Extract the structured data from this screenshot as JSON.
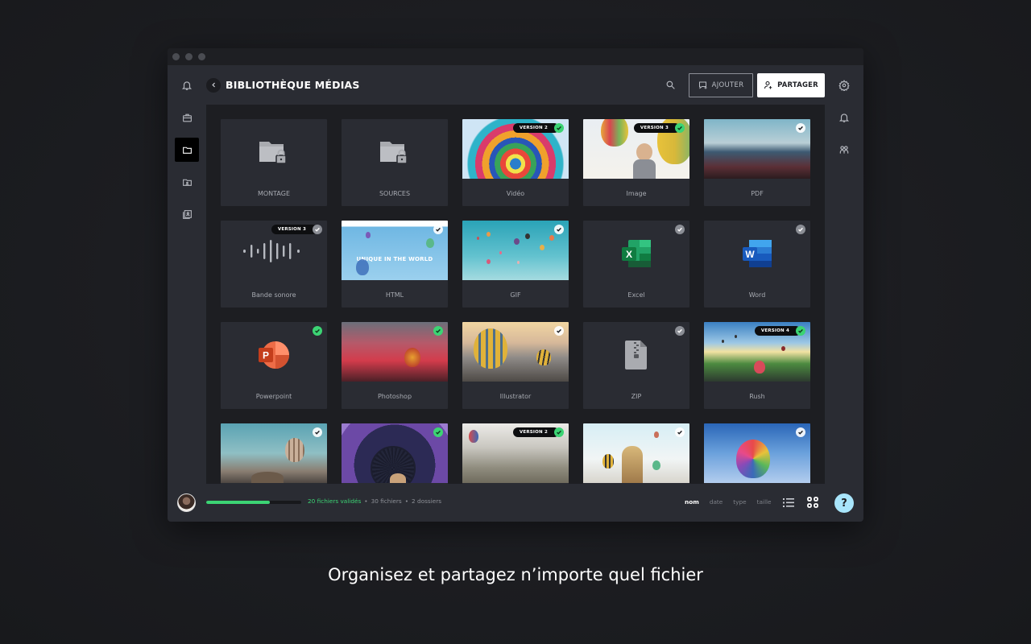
{
  "window": {
    "title": "BIBLIOTHÈQUE MÉDIAS"
  },
  "header": {
    "back_icon": "chevron-left-icon",
    "title": "BIBLIOTHÈQUE MÉDIAS",
    "search_icon": "search-icon",
    "add_label": "AJOUTER",
    "share_label": "PARTAGER",
    "settings_icon": "gear-icon"
  },
  "left_rail": {
    "items": [
      {
        "name": "notifications",
        "icon": "bell-icon"
      },
      {
        "name": "projects",
        "icon": "briefcase-icon"
      },
      {
        "name": "media-library",
        "icon": "folder-icon",
        "active": true
      },
      {
        "name": "shared-folder",
        "icon": "folder-user-icon"
      },
      {
        "name": "contacts",
        "icon": "contact-book-icon"
      }
    ]
  },
  "right_rail": {
    "items": [
      {
        "name": "settings",
        "icon": "gear-icon"
      },
      {
        "name": "notifications",
        "icon": "bell-icon"
      },
      {
        "name": "team",
        "icon": "team-icon"
      }
    ]
  },
  "files": [
    {
      "label": "MONTAGE",
      "kind": "locked-folder",
      "check": null,
      "version": null
    },
    {
      "label": "SOURCES",
      "kind": "locked-folder",
      "check": null,
      "version": null
    },
    {
      "label": "Vidéo",
      "kind": "thumb",
      "check": "green",
      "version": "VERSION 2"
    },
    {
      "label": "Image",
      "kind": "thumb",
      "check": "green",
      "version": "VERSION 3"
    },
    {
      "label": "PDF",
      "kind": "thumb",
      "check": "white",
      "version": null
    },
    {
      "label": "Bande sonore",
      "kind": "audio",
      "check": "grey",
      "version": "VERSION 3"
    },
    {
      "label": "HTML",
      "kind": "thumb",
      "check": "white",
      "version": null,
      "thumb_text": "UNIQUE IN THE WORLD"
    },
    {
      "label": "GIF",
      "kind": "thumb",
      "check": "white",
      "version": null
    },
    {
      "label": "Excel",
      "kind": "excel",
      "check": "grey",
      "version": null
    },
    {
      "label": "Word",
      "kind": "word",
      "check": "grey",
      "version": null
    },
    {
      "label": "Powerpoint",
      "kind": "powerpoint",
      "check": "green",
      "version": null
    },
    {
      "label": "Photoshop",
      "kind": "thumb",
      "check": "green",
      "version": null
    },
    {
      "label": "Illustrator",
      "kind": "thumb",
      "check": "white",
      "version": null
    },
    {
      "label": "ZIP",
      "kind": "zip",
      "check": "grey",
      "version": null
    },
    {
      "label": "Rush",
      "kind": "thumb",
      "check": "green",
      "version": "VERSION 4"
    },
    {
      "label": "",
      "kind": "thumb",
      "check": "white",
      "version": null
    },
    {
      "label": "",
      "kind": "thumb",
      "check": "green",
      "version": null
    },
    {
      "label": "",
      "kind": "thumb",
      "check": "green",
      "version": "VERSION 2"
    },
    {
      "label": "",
      "kind": "thumb",
      "check": "white",
      "version": null
    },
    {
      "label": "",
      "kind": "thumb",
      "check": "white",
      "version": null
    }
  ],
  "footer": {
    "progress_fraction": 0.6667,
    "validated_label": "20 fichiers validés",
    "separator": "•",
    "files_label": "30 fichiers",
    "folders_label": "2 dossiers",
    "sort_options": [
      "nom",
      "date",
      "type",
      "taille"
    ],
    "sort_active": "nom",
    "list_view_icon": "list-view-icon",
    "grid_view_icon": "grid-view-icon",
    "help_label": "?"
  },
  "colors": {
    "accent_green": "#3cd474",
    "help_blue": "#a8e5fb"
  },
  "tagline": "Organisez et partagez n’importe quel fichier"
}
